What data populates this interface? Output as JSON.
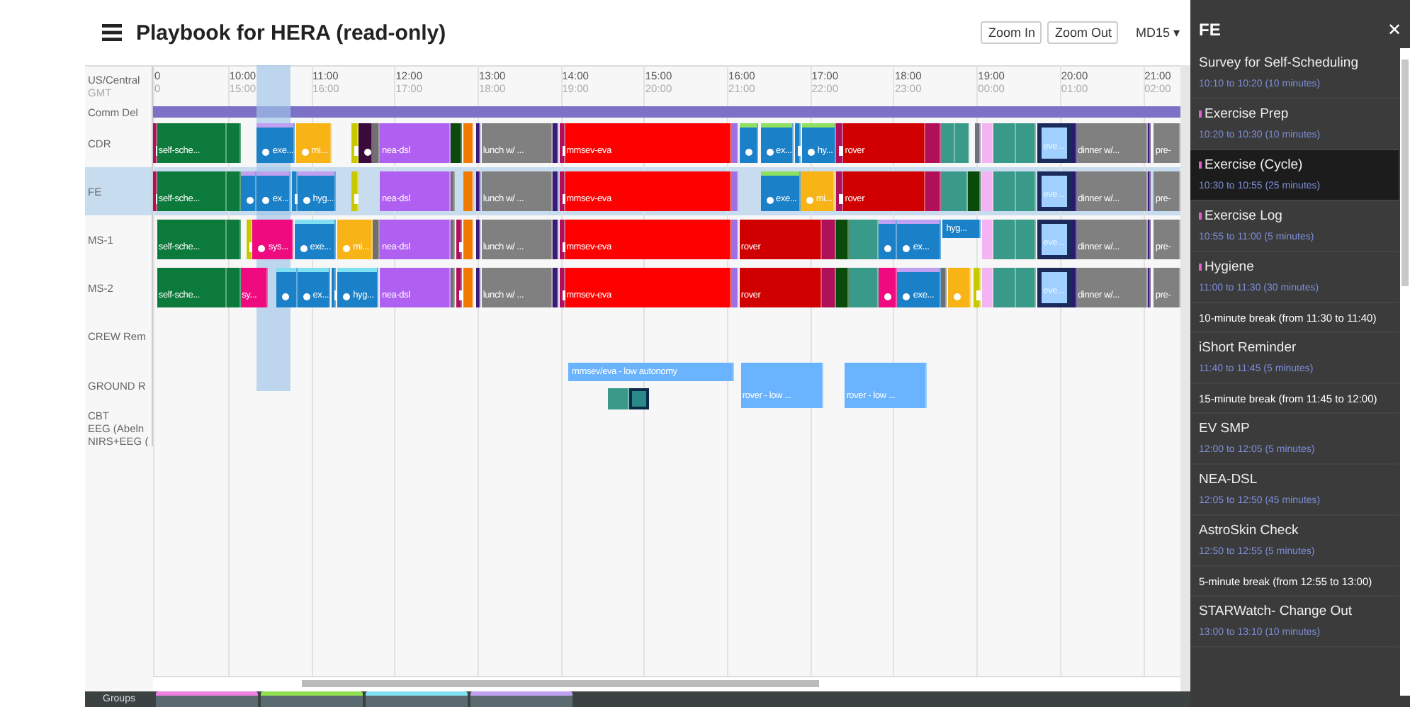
{
  "header": {
    "title": "Playbook for HERA (read-only)",
    "buttons": [
      "Zoom In",
      "Zoom Out"
    ],
    "day": "MD15 ▾"
  },
  "ruler": {
    "zone": "US/Central",
    "gmt": "GMT",
    "ticks": [
      {
        "local": "0",
        "gmt": "0"
      },
      {
        "local": "10:00",
        "gmt": "15:00"
      },
      {
        "local": "11:00",
        "gmt": "16:00"
      },
      {
        "local": "12:00",
        "gmt": "17:00"
      },
      {
        "local": "13:00",
        "gmt": "18:00"
      },
      {
        "local": "14:00",
        "gmt": "19:00"
      },
      {
        "local": "15:00",
        "gmt": "20:00"
      },
      {
        "local": "16:00",
        "gmt": "21:00"
      },
      {
        "local": "17:00",
        "gmt": "22:00"
      },
      {
        "local": "18:00",
        "gmt": "23:00"
      },
      {
        "local": "19:00",
        "gmt": "00:00"
      },
      {
        "local": "20:00",
        "gmt": "01:00"
      },
      {
        "local": "21:00",
        "gmt": "02:00"
      }
    ]
  },
  "comm_delay": {
    "label": "Comm Del",
    "color": "#7b72c8"
  },
  "crew_rows": [
    {
      "label": "CDR",
      "selected": false,
      "blocks": [
        {
          "color": "#b0105a",
          "kind": "marker"
        },
        {
          "color": "#0b7a3b",
          "kind": "plain",
          "label": "self-sche..."
        },
        {
          "color": "#0b7a3b",
          "kind": "plain"
        },
        {
          "color": "#1a80c8",
          "kind": "dot",
          "label": "exe...",
          "stripe": {
            "color": "#c0a0f0"
          }
        },
        {
          "color": "#f8b416",
          "kind": "dot",
          "label": "mi..."
        },
        {
          "color": "#c8c800",
          "kind": "marker"
        },
        {
          "color": "#3a0a3a",
          "kind": "dot"
        },
        {
          "color": "#707070",
          "kind": "plain"
        },
        {
          "color": "#b060f0",
          "kind": "plain",
          "label": "nea-dsl"
        },
        {
          "color": "#0a4a0a",
          "kind": "plain"
        },
        {
          "color": "#f07a00",
          "kind": "plain"
        },
        {
          "color": "#3a1a7a",
          "kind": "plain"
        },
        {
          "color": "#808080",
          "kind": "plain",
          "label": "lunch w/ ..."
        },
        {
          "color": "#3a1a7a",
          "kind": "plain"
        },
        {
          "color": "#b0105a",
          "kind": "marker"
        },
        {
          "color": "#ff0000",
          "kind": "plain",
          "label": "mmsev-eva"
        },
        {
          "color": "#a070e0",
          "kind": "plain"
        },
        {
          "color": "#1a80c8",
          "kind": "dot",
          "stripe": {
            "color": "#8ee060"
          }
        },
        {
          "color": "#1a80c8",
          "kind": "dot",
          "label": "ex...",
          "stripe": {
            "color": "#8ee060"
          }
        },
        {
          "color": "#1a80c8",
          "kind": "marker"
        },
        {
          "color": "#1a80c8",
          "kind": "dot",
          "label": "hy...",
          "stripe": {
            "color": "#8ee060"
          }
        },
        {
          "color": "#b0105a",
          "kind": "marker"
        },
        {
          "color": "#d00000",
          "kind": "plain",
          "label": "rover"
        },
        {
          "color": "#b0105a",
          "kind": "plain"
        },
        {
          "color": "#3a9a8a",
          "kind": "plain"
        },
        {
          "color": "#3a9a8a",
          "kind": "plain"
        },
        {
          "color": "#707080",
          "kind": "plain"
        },
        {
          "color": "#f4b4f4",
          "kind": "plain"
        },
        {
          "color": "#3a9a8a",
          "kind": "plain"
        },
        {
          "color": "#3a9a8a",
          "kind": "plain"
        },
        {
          "color": "#a0d0ff",
          "kind": "outlined",
          "label": "eve..."
        },
        {
          "color": "#2a1a6a",
          "kind": "plain"
        },
        {
          "color": "#808080",
          "kind": "plain",
          "label": "dinner w/..."
        },
        {
          "color": "#3a1a7a",
          "kind": "plain"
        },
        {
          "color": "#808080",
          "kind": "plain",
          "label": "pre-"
        }
      ]
    },
    {
      "label": "FE",
      "selected": true,
      "blocks": [
        {
          "color": "#b0105a",
          "kind": "marker"
        },
        {
          "color": "#0b7a3b",
          "kind": "plain",
          "label": "self-sche..."
        },
        {
          "color": "#0b7a3b",
          "kind": "plain"
        },
        {
          "color": "#1a80c8",
          "kind": "dot",
          "stripe": {
            "color": "#c0a0f0"
          }
        },
        {
          "color": "#1a80c8",
          "kind": "dot",
          "label": "ex...",
          "stripe": {
            "color": "#c0a0f0"
          }
        },
        {
          "color": "#1a80c8",
          "kind": "marker"
        },
        {
          "color": "#1a80c8",
          "kind": "dot",
          "label": "hyg...",
          "stripe": {
            "color": "#c0a0f0"
          }
        },
        {
          "color": "#c8c800",
          "kind": "marker"
        },
        {
          "color": "#b060f0",
          "kind": "plain",
          "label": "nea-dsl"
        },
        {
          "color": "#707070",
          "kind": "plain"
        },
        {
          "color": "#f07a00",
          "kind": "plain"
        },
        {
          "color": "#3a1a7a",
          "kind": "plain"
        },
        {
          "color": "#808080",
          "kind": "plain",
          "label": "lunch w/ ..."
        },
        {
          "color": "#3a1a7a",
          "kind": "plain"
        },
        {
          "color": "#b0105a",
          "kind": "marker"
        },
        {
          "color": "#ff0000",
          "kind": "plain",
          "label": "mmsev-eva"
        },
        {
          "color": "#a070e0",
          "kind": "plain"
        },
        {
          "color": "#1a80c8",
          "kind": "dot",
          "label": "exe...",
          "stripe": {
            "color": "#8ee060"
          }
        },
        {
          "color": "#f8b416",
          "kind": "dot",
          "label": "mi..."
        },
        {
          "color": "#b0105a",
          "kind": "marker"
        },
        {
          "color": "#d00000",
          "kind": "plain",
          "label": "rover"
        },
        {
          "color": "#b0105a",
          "kind": "plain"
        },
        {
          "color": "#3a9a8a",
          "kind": "plain"
        },
        {
          "color": "#0a4a0a",
          "kind": "plain"
        },
        {
          "color": "#f4b4f4",
          "kind": "plain"
        },
        {
          "color": "#3a9a8a",
          "kind": "plain"
        },
        {
          "color": "#3a9a8a",
          "kind": "plain"
        },
        {
          "color": "#a0d0ff",
          "kind": "outlined",
          "label": "eve..."
        },
        {
          "color": "#2a1a6a",
          "kind": "plain"
        },
        {
          "color": "#808080",
          "kind": "plain",
          "label": "dinner w/..."
        },
        {
          "color": "#3a1a7a",
          "kind": "plain"
        },
        {
          "color": "#808080",
          "kind": "plain",
          "label": "pre-"
        }
      ]
    },
    {
      "label": "MS-1",
      "selected": false,
      "blocks": [
        {
          "color": "#0b7a3b",
          "kind": "plain",
          "label": "self-sche..."
        },
        {
          "color": "#0b7a3b",
          "kind": "plain"
        },
        {
          "color": "#c8c800",
          "kind": "marker"
        },
        {
          "color": "#f00a80",
          "kind": "dot",
          "label": "sys..."
        },
        {
          "color": "#1a80c8",
          "kind": "dot",
          "label": "exe...",
          "stripe": {
            "color": "#80e0f0"
          }
        },
        {
          "color": "#f8b416",
          "kind": "dot",
          "label": "mi..."
        },
        {
          "color": "#707070",
          "kind": "plain"
        },
        {
          "color": "#b060f0",
          "kind": "plain",
          "label": "nea-dsl"
        },
        {
          "color": "#707070",
          "kind": "plain"
        },
        {
          "color": "#b0105a",
          "kind": "marker"
        },
        {
          "color": "#f07a00",
          "kind": "plain"
        },
        {
          "color": "#3a1a7a",
          "kind": "plain"
        },
        {
          "color": "#808080",
          "kind": "plain",
          "label": "lunch w/ ..."
        },
        {
          "color": "#3a1a7a",
          "kind": "plain"
        },
        {
          "color": "#b0105a",
          "kind": "marker"
        },
        {
          "color": "#ff0000",
          "kind": "plain",
          "label": "mmsev-eva"
        },
        {
          "color": "#a070e0",
          "kind": "plain"
        },
        {
          "color": "#d00000",
          "kind": "plain",
          "label": "rover"
        },
        {
          "color": "#b0105a",
          "kind": "plain"
        },
        {
          "color": "#0a4a0a",
          "kind": "plain"
        },
        {
          "color": "#3a9a8a",
          "kind": "plain"
        },
        {
          "color": "#1a80c8",
          "kind": "dot",
          "stripe": {
            "color": "#c0a0f0"
          }
        },
        {
          "color": "#1a80c8",
          "kind": "dot",
          "label": "ex...",
          "stripe": {
            "color": "#c0a0f0"
          }
        },
        {
          "color": "#1a80c8",
          "kind": "upper",
          "label": "hyg..."
        },
        {
          "color": "#f4b4f4",
          "kind": "plain"
        },
        {
          "color": "#3a9a8a",
          "kind": "plain"
        },
        {
          "color": "#3a9a8a",
          "kind": "plain"
        },
        {
          "color": "#a0d0ff",
          "kind": "outlined",
          "label": "eve..."
        },
        {
          "color": "#2a1a6a",
          "kind": "plain"
        },
        {
          "color": "#808080",
          "kind": "plain",
          "label": "dinner w/..."
        },
        {
          "color": "#3a1a7a",
          "kind": "plain"
        },
        {
          "color": "#808080",
          "kind": "plain",
          "label": "pre-"
        }
      ]
    },
    {
      "label": "MS-2",
      "selected": false,
      "blocks": [
        {
          "color": "#0b7a3b",
          "kind": "plain",
          "label": "self-sche..."
        },
        {
          "color": "#0b7a3b",
          "kind": "plain"
        },
        {
          "color": "#f00a80",
          "kind": "plain",
          "label": "sy..."
        },
        {
          "color": "#1a80c8",
          "kind": "dot",
          "stripe": {
            "color": "#80e0f0"
          }
        },
        {
          "color": "#1a80c8",
          "kind": "dot",
          "label": "ex...",
          "stripe": {
            "color": "#80e0f0"
          }
        },
        {
          "color": "#1a80c8",
          "kind": "marker"
        },
        {
          "color": "#1a80c8",
          "kind": "dot",
          "label": "hyg...",
          "stripe": {
            "color": "#80e0f0"
          }
        },
        {
          "color": "#b060f0",
          "kind": "plain",
          "label": "nea-dsl"
        },
        {
          "color": "#707070",
          "kind": "plain"
        },
        {
          "color": "#b0105a",
          "kind": "marker"
        },
        {
          "color": "#f07a00",
          "kind": "plain"
        },
        {
          "color": "#3a1a7a",
          "kind": "plain"
        },
        {
          "color": "#808080",
          "kind": "plain",
          "label": "lunch w/ ..."
        },
        {
          "color": "#3a1a7a",
          "kind": "plain"
        },
        {
          "color": "#b0105a",
          "kind": "marker"
        },
        {
          "color": "#ff0000",
          "kind": "plain",
          "label": "mmsev-eva"
        },
        {
          "color": "#a070e0",
          "kind": "plain"
        },
        {
          "color": "#d00000",
          "kind": "plain",
          "label": "rover"
        },
        {
          "color": "#b0105a",
          "kind": "plain"
        },
        {
          "color": "#0a4a0a",
          "kind": "plain"
        },
        {
          "color": "#3a9a8a",
          "kind": "plain"
        },
        {
          "color": "#f00a80",
          "kind": "dot"
        },
        {
          "color": "#1a80c8",
          "kind": "dot",
          "label": "exe...",
          "stripe": {
            "color": "#c0a0f0"
          }
        },
        {
          "color": "#707070",
          "kind": "plain"
        },
        {
          "color": "#f8b416",
          "kind": "dot"
        },
        {
          "color": "#c8c800",
          "kind": "marker"
        },
        {
          "color": "#f4b4f4",
          "kind": "plain"
        },
        {
          "color": "#3a9a8a",
          "kind": "plain"
        },
        {
          "color": "#3a9a8a",
          "kind": "plain"
        },
        {
          "color": "#a0d0ff",
          "kind": "outlined",
          "label": "eve..."
        },
        {
          "color": "#2a1a6a",
          "kind": "plain"
        },
        {
          "color": "#808080",
          "kind": "plain",
          "label": "dinner w/..."
        },
        {
          "color": "#3a1a7a",
          "kind": "plain"
        },
        {
          "color": "#808080",
          "kind": "plain",
          "label": "pre-"
        }
      ]
    }
  ],
  "crew_reminder": {
    "label": "CREW Rem"
  },
  "ground_row": {
    "label": "GROUND R",
    "blocks": [
      {
        "color": "#6ab4ff",
        "kind": "upper",
        "label": "mmsev/eva - low autonomy"
      },
      {
        "color": "#3a9a8a",
        "kind": "lower"
      },
      {
        "color": "#2a8a8a",
        "kind": "framed"
      },
      {
        "color": "#6ab4ff",
        "kind": "plain",
        "label": "rover - low ..."
      },
      {
        "color": "#6ab4ff",
        "kind": "plain",
        "label": "rover - low ..."
      }
    ]
  },
  "other_labels": [
    "CBT",
    "EEG (Abeln",
    "NIRS+EEG ("
  ],
  "groups": {
    "label": "Groups",
    "items": [
      {
        "color": "#f080e0"
      },
      {
        "color": "#90e050"
      },
      {
        "color": "#80e0f0"
      },
      {
        "color": "#c0a0f0"
      }
    ]
  },
  "panel": {
    "title": "FE",
    "close": "✕",
    "items": [
      {
        "kind": "activity",
        "title": "Survey for Self-Scheduling",
        "time": "10:10 to 10:20 (10 minutes)",
        "flagged": false,
        "selected": false
      },
      {
        "kind": "activity",
        "title": "Exercise Prep",
        "time": "10:20 to 10:30 (10 minutes)",
        "flagged": true,
        "selected": false
      },
      {
        "kind": "activity",
        "title": "Exercise (Cycle)",
        "time": "10:30 to 10:55 (25 minutes)",
        "flagged": true,
        "selected": true
      },
      {
        "kind": "activity",
        "title": "Exercise Log",
        "time": "10:55 to 11:00 (5 minutes)",
        "flagged": true,
        "selected": false
      },
      {
        "kind": "activity",
        "title": "Hygiene",
        "time": "11:00 to 11:30 (30 minutes)",
        "flagged": true,
        "selected": false
      },
      {
        "kind": "break",
        "title": "10-minute break (from 11:30 to 11:40)"
      },
      {
        "kind": "activity",
        "title": "iShort Reminder",
        "time": "11:40 to 11:45 (5 minutes)",
        "flagged": false,
        "selected": false
      },
      {
        "kind": "break",
        "title": "15-minute break (from 11:45 to 12:00)"
      },
      {
        "kind": "activity",
        "title": "EV SMP",
        "time": "12:00 to 12:05 (5 minutes)",
        "flagged": false,
        "selected": false
      },
      {
        "kind": "activity",
        "title": "NEA-DSL",
        "time": "12:05 to 12:50 (45 minutes)",
        "flagged": false,
        "selected": false
      },
      {
        "kind": "activity",
        "title": "AstroSkin Check",
        "time": "12:50 to 12:55 (5 minutes)",
        "flagged": false,
        "selected": false
      },
      {
        "kind": "break",
        "title": "5-minute break (from 12:55 to 13:00)"
      },
      {
        "kind": "activity",
        "title": "STARWatch- Change Out",
        "time": "13:00 to 13:10 (10 minutes)",
        "flagged": false,
        "selected": false
      }
    ]
  }
}
